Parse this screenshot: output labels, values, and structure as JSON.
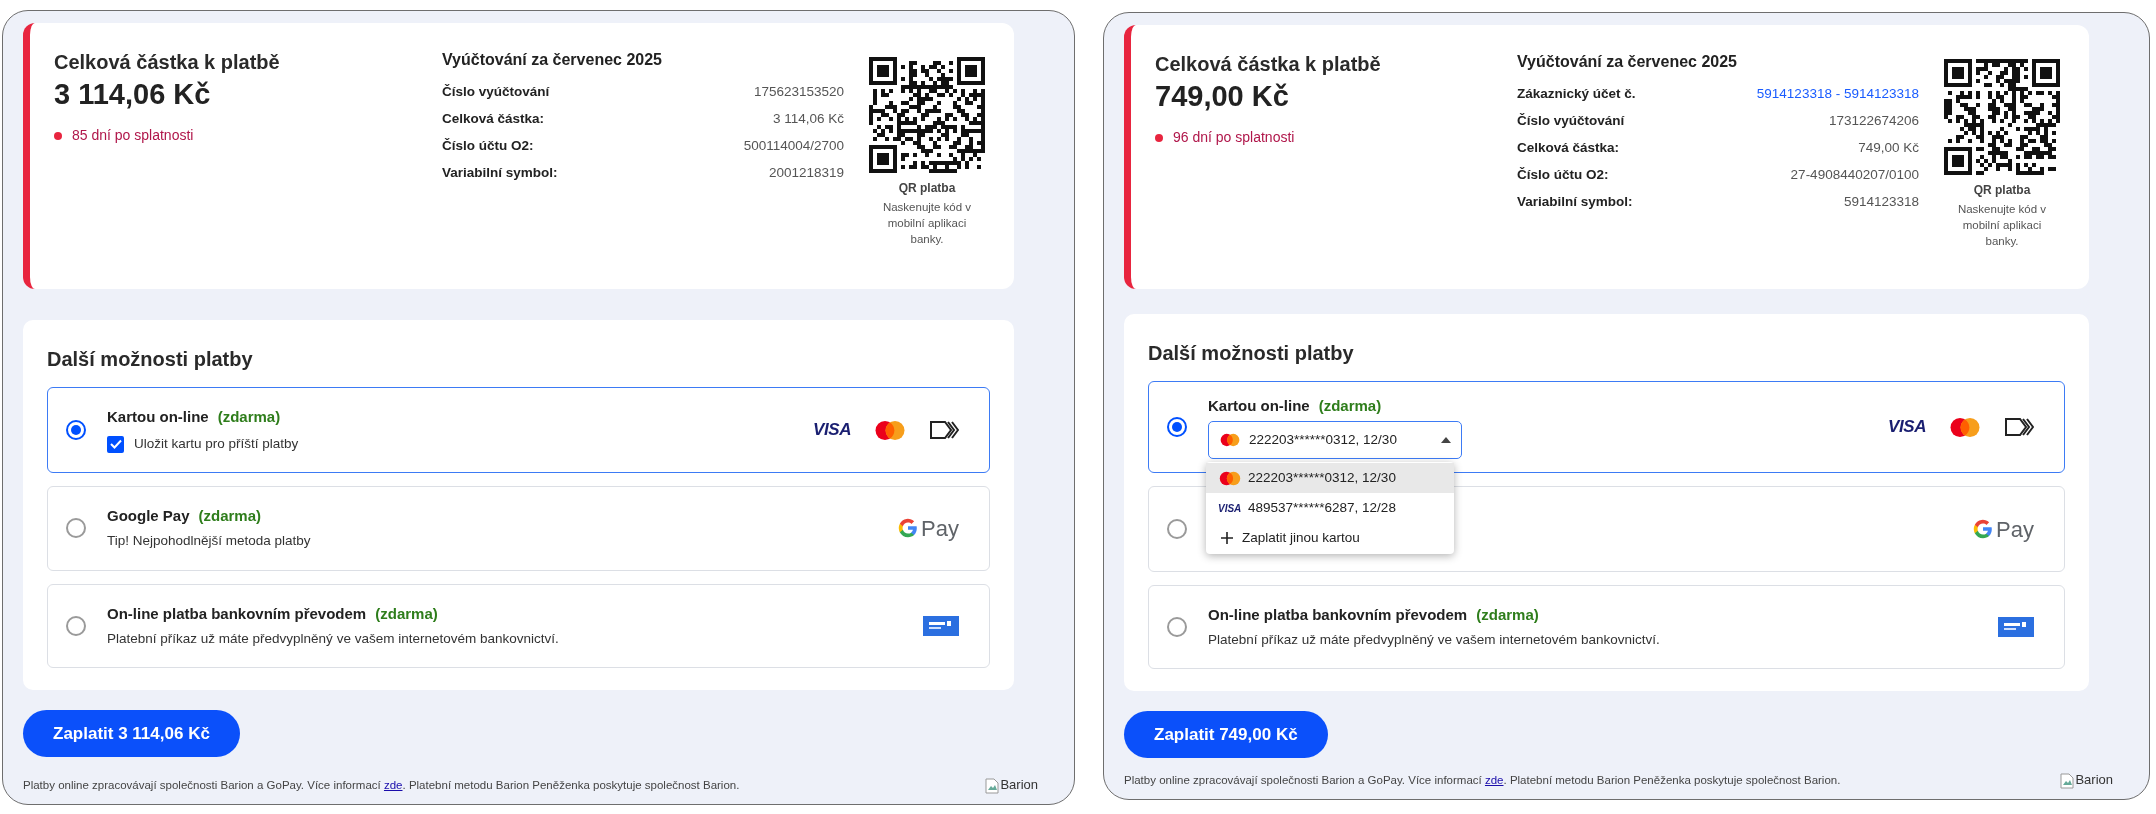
{
  "panels": [
    {
      "summary": {
        "title": "Celková částka k platbě",
        "amount": "3 114,06 Kč",
        "overdue": "85 dní po splatnosti",
        "billing_title": "Vyúčtování za červenec 2025",
        "rows": [
          {
            "label": "Číslo vyúčtování",
            "value": "175623153520",
            "kind": "text"
          },
          {
            "label": "Celková částka:",
            "value": "3 114,06 Kč",
            "kind": "text"
          },
          {
            "label": "Číslo účtu O2:",
            "value": "500114004/2700",
            "kind": "text"
          },
          {
            "label": "Variabilní symbol:",
            "value": "2001218319",
            "kind": "text"
          }
        ],
        "qr": {
          "title": "QR platba",
          "hint": "Naskenujte kód v mobilní aplikaci banky."
        }
      },
      "options": {
        "heading": "Další možnosti platby",
        "items": [
          {
            "title": "Kartou on-line",
            "badge": "(zdarma)",
            "selected": true,
            "save_card": {
              "label": "Uložit kartu pro příští platby",
              "checked": true
            },
            "logos": [
              {
                "kind": "visa",
                "text": "VISA"
              },
              {
                "kind": "mastercard"
              },
              {
                "kind": "contactless"
              }
            ]
          },
          {
            "title": "Google Pay",
            "badge": "(zdarma)",
            "subtitle": "Tip! Nejpohodlnější metoda platby",
            "selected": false,
            "logos": [
              {
                "kind": "gpay",
                "text": "Pay"
              }
            ]
          },
          {
            "title": "On-line platba bankovním převodem",
            "badge": "(zdarma)",
            "subtitle": "Platební příkaz už máte předvyplněný ve vašem internetovém bankovnictví.",
            "selected": false,
            "logos": [
              {
                "kind": "bank"
              }
            ]
          }
        ]
      },
      "pay_button": "Zaplatit 3 114,06 Kč",
      "footer": {
        "before": "Platby online zpracovávají společnosti Barion a GoPay. Více informací ",
        "link": "zde",
        "after": ". Platební metodu Barion Peněženka poskytuje společnost Barion.",
        "image_alt": "Barion"
      }
    },
    {
      "summary": {
        "title": "Celková částka k platbě",
        "amount": "749,00 Kč",
        "overdue": "96 dní po splatnosti",
        "billing_title": "Vyúčtování za červenec 2025",
        "rows": [
          {
            "label": "Zákaznický účet č.",
            "value": "5914123318 - 5914123318",
            "kind": "link"
          },
          {
            "label": "Číslo vyúčtování",
            "value": "173122674206",
            "kind": "text"
          },
          {
            "label": "Celková částka:",
            "value": "749,00 Kč",
            "kind": "text"
          },
          {
            "label": "Číslo účtu O2:",
            "value": "27-4908440207/0100",
            "kind": "text"
          },
          {
            "label": "Variabilní symbol:",
            "value": "5914123318",
            "kind": "text"
          }
        ],
        "qr": {
          "title": "QR platba",
          "hint": "Naskenujte kód v mobilní aplikaci banky."
        }
      },
      "options": {
        "heading": "Další možnosti platby",
        "items": [
          {
            "title": "Kartou on-line",
            "badge": "(zdarma)",
            "selected": true,
            "card_select": {
              "value": "222203******0312, 12/30",
              "expanded": true,
              "menu": [
                {
                  "kind": "mastercard",
                  "label": "222203******0312, 12/30",
                  "selected": true
                },
                {
                  "kind": "visa",
                  "logo_text": "VISA",
                  "label": "489537******6287, 12/28",
                  "selected": false
                },
                {
                  "kind": "add",
                  "label": "Zaplatit jinou kartou",
                  "selected": false
                }
              ]
            },
            "logos": [
              {
                "kind": "visa",
                "text": "VISA"
              },
              {
                "kind": "mastercard"
              },
              {
                "kind": "contactless"
              }
            ]
          },
          {
            "selected": false,
            "logos": [
              {
                "kind": "gpay",
                "text": "Pay"
              }
            ]
          },
          {
            "title": "On-line platba bankovním převodem",
            "badge": "(zdarma)",
            "subtitle": "Platební příkaz už máte předvyplněný ve vašem internetovém bankovnictví.",
            "selected": false,
            "logos": [
              {
                "kind": "bank"
              }
            ]
          }
        ]
      },
      "pay_button": "Zaplatit 749,00 Kč",
      "footer": {
        "before": "Platby online zpracovávají společnosti Barion a GoPay. Více informací ",
        "link": "zde",
        "after": ". Platební metodu Barion Peněženka poskytuje společnost Barion.",
        "image_alt": "Barion"
      }
    }
  ]
}
